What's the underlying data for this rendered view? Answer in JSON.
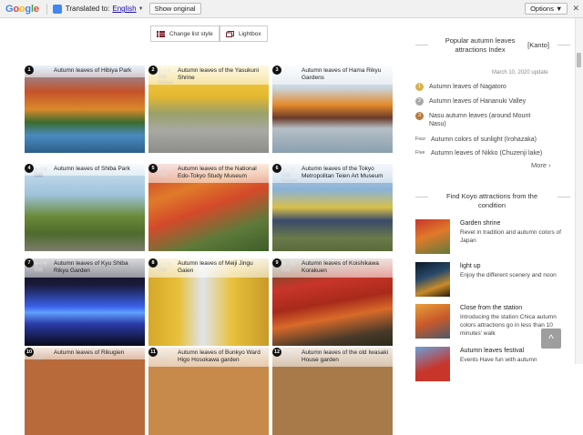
{
  "translate_bar": {
    "logo": "Google",
    "translated_to_label": "Translated to:",
    "language": "English",
    "show_original": "Show original",
    "options": "Options ▼"
  },
  "toolbar": {
    "change_list_style": "Change list style",
    "lightbox": "Lightbox"
  },
  "spots": [
    {
      "num": "1",
      "title": "Autumn leaves of Hibiya Park",
      "stamp": ""
    },
    {
      "num": "2",
      "title": "Autumn leaves of the Yasukuni Shrine",
      "stamp": "色づき\n情報\nNoData"
    },
    {
      "num": "3",
      "title": "Autumn leaves of Hama Rikyu Gardens",
      "stamp": ""
    },
    {
      "num": "4",
      "title": "Autumn leaves of Shiba Park",
      "stamp": "色づき\n情報"
    },
    {
      "num": "5",
      "title": "Autumn leaves of the National Edo-Tokyo Study Museum",
      "stamp": "色づき\n情報"
    },
    {
      "num": "6",
      "title": "Autumn leaves of the Tokyo Metropolitan Teien Art Museum",
      "stamp": "色づき\n情報\nNoData"
    },
    {
      "num": "7",
      "title": "Autumn leaves of Kyu Shiba Rikyu Garden",
      "stamp": "色づき\n情報"
    },
    {
      "num": "8",
      "title": "Autumn leaves of Meiji Jingu Gaien",
      "stamp": "色づき\n情報"
    },
    {
      "num": "9",
      "title": "Autumn leaves of Koishikawa Korakuen",
      "stamp": "色づき\n情報"
    },
    {
      "num": "10",
      "title": "Autumn leaves of Rikugien",
      "stamp": "色づき\n情報"
    },
    {
      "num": "11",
      "title": "Autumn leaves of Bunkyo Ward Higo Hosokawa garden",
      "stamp": "色づき\n情報"
    },
    {
      "num": "12",
      "title": "Autumn leaves of the old Iwasaki House garden",
      "stamp": "色づき\n情報"
    }
  ],
  "sidebar": {
    "ranking_title": "Popular autumn leaves attractions Index",
    "region": "[Kanto]",
    "update": "March 10, 2020 update",
    "ranking": [
      {
        "badge": "1",
        "label": "Autumn leaves of Nagatoro",
        "color": "#d8b04a"
      },
      {
        "badge": "2",
        "label": "Autumn leaves of Hananuki Valley",
        "color": "#a9a9a9"
      },
      {
        "badge": "3",
        "label": "Nasu autumn leaves (around Mount Nasu)",
        "color": "#b87a3d"
      },
      {
        "badge": "Four",
        "label": "Autumn colors of sunlight (Irohazaka)",
        "color": ""
      },
      {
        "badge": "Five",
        "label": "Autumn leaves of Nikko (Chuzenji lake)",
        "color": ""
      }
    ],
    "more": "More ›",
    "condition_title": "Find Koyo attractions from the condition",
    "conditions": [
      {
        "title": "Garden shrine",
        "desc": "Revel in tradition and autumn colors of Japan"
      },
      {
        "title": "light up",
        "desc": "Enjoy the different scenery and noon"
      },
      {
        "title": "Close from the station",
        "desc": "Introducing the station Chica autumn colors attractions go in less than 10 minutes' walk"
      },
      {
        "title": "Autumn leaves festival",
        "desc": "Events Have fun with autumn"
      }
    ],
    "to_top": "^"
  }
}
